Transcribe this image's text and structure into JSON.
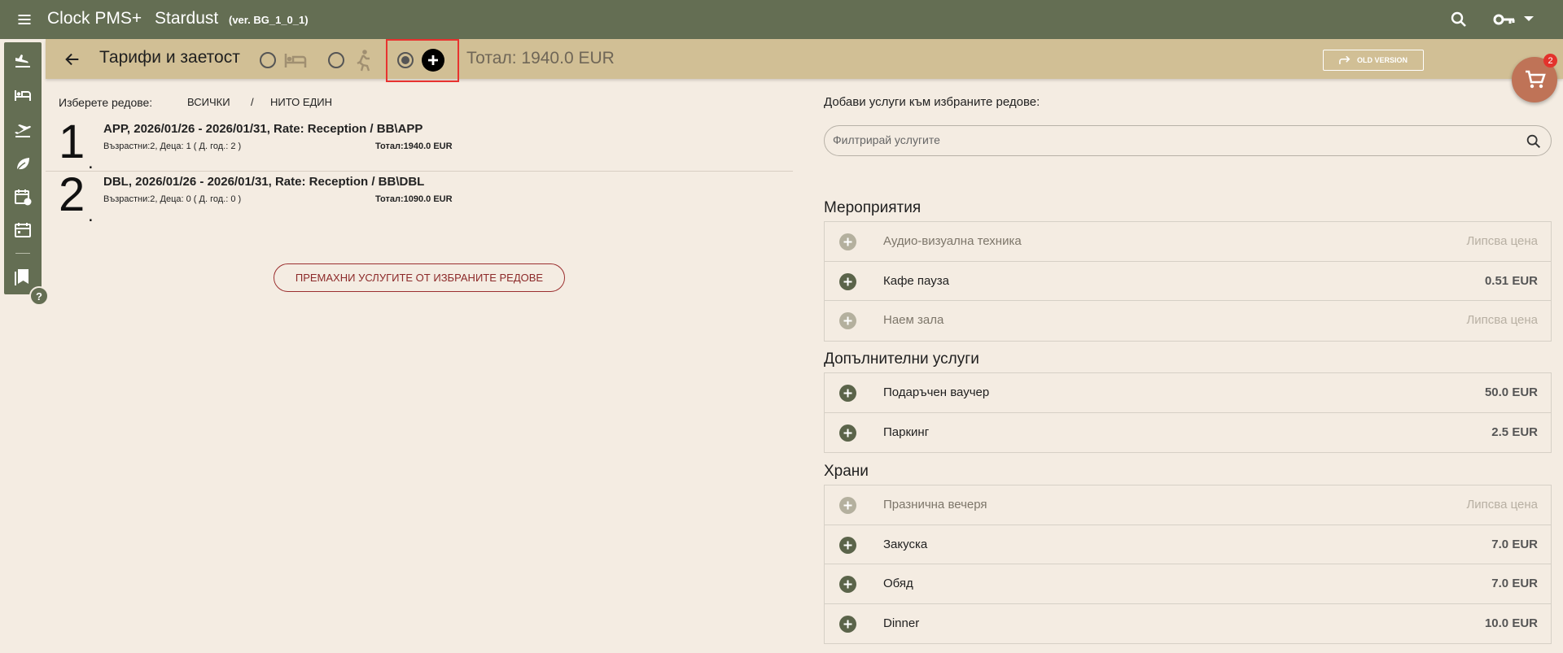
{
  "app": {
    "title": "Clock PMS+",
    "hotel": "Stardust",
    "version": "(ver. BG_1_0_1)"
  },
  "subheader": {
    "title": "Тарифи и заетост",
    "total": "Тотал: 1940.0 EUR",
    "old_version_label": "OLD VERSION"
  },
  "cart": {
    "badge": "2"
  },
  "selection": {
    "label": "Изберете редове:",
    "all": "ВСИЧКИ",
    "separator": "/",
    "none": "НИТО ЕДИН"
  },
  "reservation_lines": [
    {
      "number": "1",
      "title": "APP, 2026/01/26 - 2026/01/31, Rate: Reception / BB\\APP",
      "guests": "Възрастни:2, Деца: 1 ( Д. год.: 2 )",
      "total": "Тотал:1940.0 EUR"
    },
    {
      "number": "2",
      "title": "DBL, 2026/01/26 - 2026/01/31, Rate: Reception / BB\\DBL",
      "guests": "Възрастни:2, Деца: 0 ( Д. год.: 0 )",
      "total": "Тотал:1090.0 EUR"
    }
  ],
  "remove_button": "ПРЕМАХНИ УСЛУГИТЕ ОТ ИЗБРАНИТЕ РЕДОВЕ",
  "services": {
    "header": "Добави услуги към избраните редове:",
    "filter_placeholder": "Филтрирай услугите",
    "groups": [
      {
        "title": "Мероприятия",
        "items": [
          {
            "name": "Аудио-визуална техника",
            "price": "Липсва цена",
            "available": false
          },
          {
            "name": "Кафе пауза",
            "price": "0.51 EUR",
            "available": true
          },
          {
            "name": "Наем зала",
            "price": "Липсва цена",
            "available": false
          }
        ]
      },
      {
        "title": "Допълнителни услуги",
        "items": [
          {
            "name": "Подаръчен ваучер",
            "price": "50.0 EUR",
            "available": true
          },
          {
            "name": "Паркинг",
            "price": "2.5 EUR",
            "available": true
          }
        ]
      },
      {
        "title": "Храни",
        "items": [
          {
            "name": "Празнична вечеря",
            "price": "Липсва цена",
            "available": false
          },
          {
            "name": "Закуска",
            "price": "7.0 EUR",
            "available": true
          },
          {
            "name": "Обяд",
            "price": "7.0 EUR",
            "available": true
          },
          {
            "name": "Dinner",
            "price": "10.0 EUR",
            "available": true
          }
        ]
      }
    ]
  },
  "sidebar_icons": [
    "arrivals-icon",
    "rooms-icon",
    "departures-icon",
    "leaf-icon",
    "calendar-clock-icon",
    "calendar-icon",
    "bookmarks-icon"
  ],
  "colors": {
    "topbar": "#646e53",
    "subbar": "#d1bf95",
    "background": "#f4ece2",
    "highlight": "#e8322f",
    "cart": "#bf7357"
  }
}
